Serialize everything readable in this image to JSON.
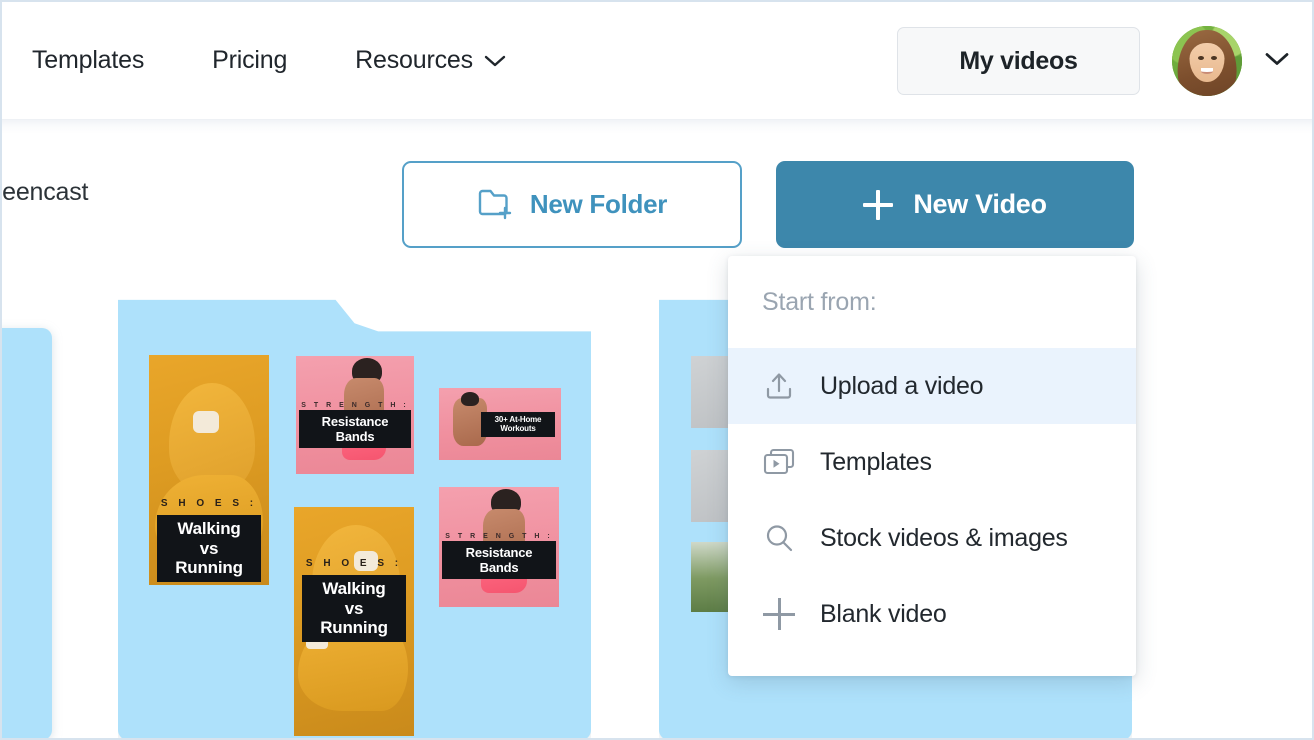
{
  "header": {
    "nav": [
      {
        "label": "Templates",
        "icon": null
      },
      {
        "label": "Pricing",
        "icon": null
      },
      {
        "label": "Resources",
        "icon": "chevron-down-icon"
      }
    ],
    "my_videos_label": "My videos",
    "avatar_icon": "user-avatar",
    "avatar_chevron_icon": "chevron-down-icon"
  },
  "action_row": {
    "folder_title": "reencast",
    "new_folder_label": "New Folder",
    "new_folder_icon": "folder-plus-icon",
    "new_video_label": "New Video",
    "new_video_icon": "plus-icon"
  },
  "menu": {
    "header_label": "Start from:",
    "items": [
      {
        "label": "Upload a video",
        "icon": "upload-icon",
        "active": true
      },
      {
        "label": "Templates",
        "icon": "template-frames-icon",
        "active": false
      },
      {
        "label": "Stock videos & images",
        "icon": "search-icon",
        "active": false
      },
      {
        "label": "Blank video",
        "icon": "plus-icon",
        "active": false
      }
    ]
  },
  "cards": [
    {
      "name": "produce-folder-card",
      "thumbs": [
        {
          "kind": "produce-strip",
          "caption": ""
        }
      ]
    },
    {
      "name": "fitness-folder-card",
      "thumbs": [
        {
          "kind": "shoes-tall",
          "kicker": "S H O E S :",
          "caption": "Walking vs\nRunning"
        },
        {
          "kind": "pink-wide",
          "kicker": "S T R E N G T H :",
          "caption": "Resistance Bands"
        },
        {
          "kind": "pink-small",
          "kicker": "",
          "caption": "30+ At-Home\nWorkouts"
        },
        {
          "kind": "pink-wide-2",
          "kicker": "S T R E N G T H :",
          "caption": "Resistance Bands"
        },
        {
          "kind": "shoes-wide",
          "kicker": "S H O E S :",
          "caption": "Walking vs\nRunning"
        }
      ]
    },
    {
      "name": "hidden-folder-card",
      "thumbs": [
        {
          "kind": "gray",
          "caption": ""
        },
        {
          "kind": "gray",
          "caption": ""
        },
        {
          "kind": "field",
          "caption": ""
        }
      ]
    }
  ],
  "colors": {
    "accent_blue": "#3d87ab",
    "outline_blue": "#55a0c8",
    "card_blue": "#aee1fb",
    "menu_highlight": "#eaf3fd",
    "text_dark": "#22282e",
    "text_muted": "#9aa5b1"
  }
}
